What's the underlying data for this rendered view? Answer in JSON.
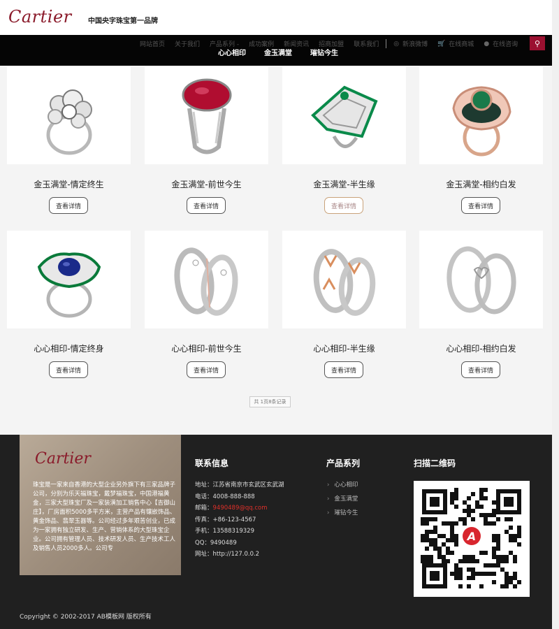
{
  "header": {
    "logo_text": "Cartier",
    "slogan": "中国央字珠宝第一品牌"
  },
  "nav": {
    "items": [
      "网站首页",
      "关于我们",
      "产品系列 -",
      "成功案例",
      "新闻资讯",
      "招商加盟",
      "联系我们"
    ],
    "weibo": "新浪微博",
    "mall": "在线商城",
    "consult": "在线咨询",
    "sub_items": [
      "心心相印",
      "金玉满堂",
      "璀钻今生"
    ]
  },
  "products": [
    {
      "name": "金玉满堂-情定终生",
      "button": "查看详情"
    },
    {
      "name": "金玉满堂-前世今生",
      "button": "查看详情"
    },
    {
      "name": "金玉满堂-半生缘",
      "button": "查看详情"
    },
    {
      "name": "金玉满堂-相约白发",
      "button": "查看详情"
    },
    {
      "name": "心心相印-情定终身",
      "button": "查看详情"
    },
    {
      "name": "心心相印-前世今生",
      "button": "查看详情"
    },
    {
      "name": "心心相印-半生缘",
      "button": "查看详情"
    },
    {
      "name": "心心相印-相约白发",
      "button": "查看详情"
    }
  ],
  "pager": "共 1页8条记录",
  "footer": {
    "about_logo": "Cartier",
    "about_text": "珠宝是一家来自香港的大型企业另外旗下有三家品牌子公司，分别为乐天福珠宝，戴梦福珠宝，中国港福黄金，三家大型珠宝厂及一家装潢加工销售中心【吉御山庄】，厂房面积5000多平方米，主营产品有镶嵌饰品、黄金饰品、翡翠玉器等。公司经过多年艰苦创业，已成为一家拥有独立研发、生产、营销体系的大型珠宝企业。公司拥有管理人员、技术研发人员、生产技术工人及销售人员2000多人。公司专",
    "contact_title": "联系信息",
    "contact": {
      "address": "地址：江苏省南京市玄武区玄武湖",
      "phone": "电话：4008-888-888",
      "email_label": "邮箱：",
      "email": "9490489@qq.com",
      "fax": "传真：+86-123-4567",
      "mobile": "手机：13588319329",
      "qq": "QQ：9490489",
      "site": "网址：http://127.0.0.2"
    },
    "products_title": "产品系列",
    "product_links": [
      "心心相印",
      "金玉满堂",
      "璀钻今生"
    ],
    "qr_title": "扫描二维码",
    "copyright": "Copyright © 2002-2017 AB模板网 版权所有"
  },
  "colors": {
    "brand": "#8a1a2a",
    "accent": "#9b1030",
    "footer_bg": "#202020"
  }
}
